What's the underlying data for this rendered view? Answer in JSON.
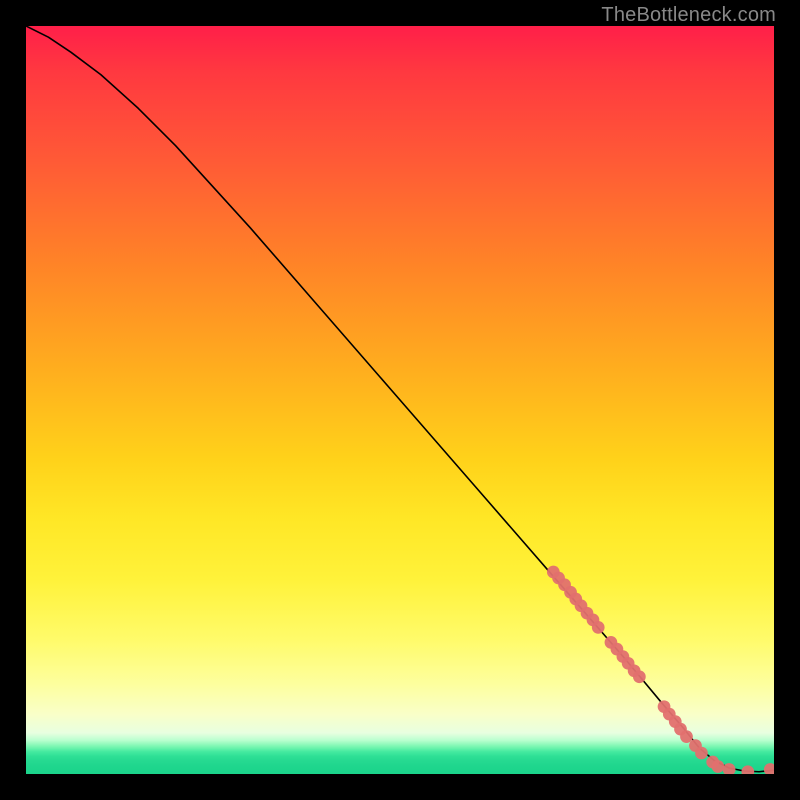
{
  "attribution": "TheBottleneck.com",
  "colors": {
    "marker": "#e2706e",
    "curve": "#000000",
    "frame": "#000000"
  },
  "chart_data": {
    "type": "line",
    "title": "",
    "xlabel": "",
    "ylabel": "",
    "xlim": [
      0,
      100
    ],
    "ylim": [
      0,
      100
    ],
    "series": [
      {
        "name": "bottleneck-curve",
        "x": [
          0,
          3,
          6,
          10,
          15,
          20,
          30,
          40,
          50,
          60,
          70,
          80,
          85,
          88,
          90,
          92,
          94,
          96,
          98,
          100
        ],
        "y": [
          100,
          98.5,
          96.5,
          93.5,
          89,
          84,
          73,
          61.5,
          50,
          38.5,
          27,
          15.5,
          9.5,
          6,
          3.5,
          1.8,
          0.8,
          0.4,
          0.3,
          0.5
        ]
      }
    ],
    "markers": {
      "name": "highlighted-points",
      "x": [
        70.5,
        71.2,
        72,
        72.8,
        73.5,
        74.2,
        75,
        75.8,
        76.5,
        78.2,
        79,
        79.8,
        80.5,
        81.3,
        82,
        85.3,
        86,
        86.8,
        87.5,
        88.3,
        89.5,
        90.3,
        91.8,
        92.5,
        94,
        96.5,
        99.5
      ],
      "y": [
        27,
        26.2,
        25.3,
        24.3,
        23.4,
        22.5,
        21.5,
        20.6,
        19.6,
        17.6,
        16.7,
        15.7,
        14.8,
        13.8,
        13,
        9,
        8,
        7,
        6,
        5,
        3.8,
        2.8,
        1.6,
        1,
        0.6,
        0.3,
        0.6
      ]
    }
  }
}
